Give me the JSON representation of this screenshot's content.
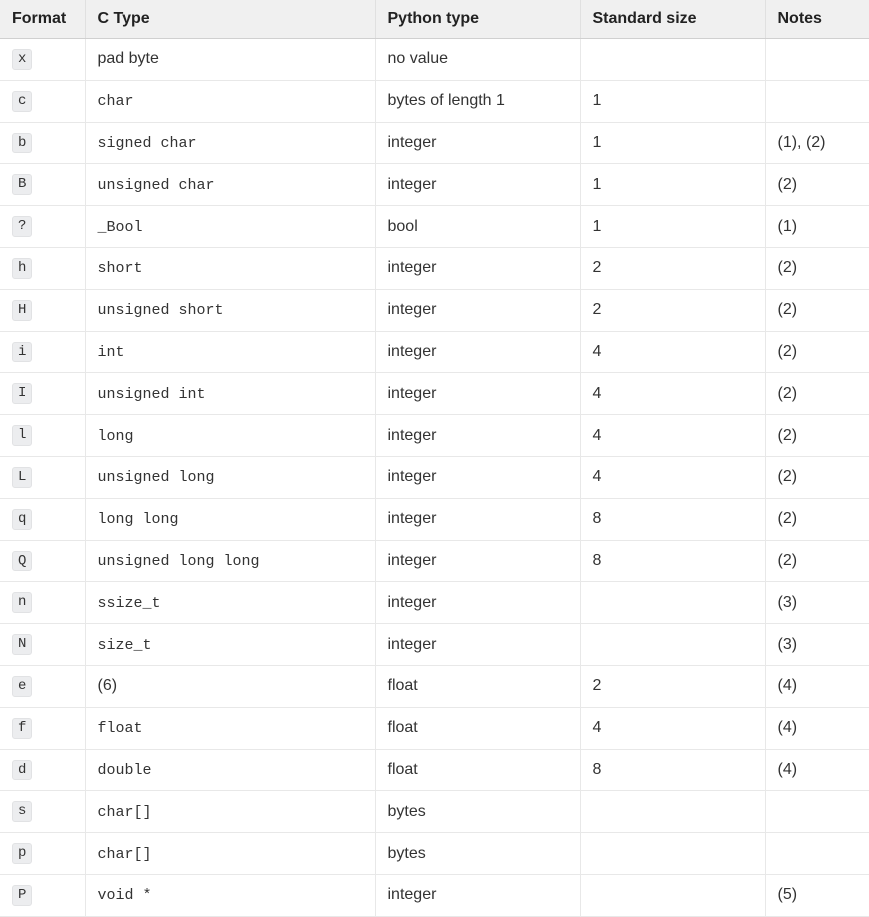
{
  "headers": {
    "format": "Format",
    "ctype": "C Type",
    "python": "Python type",
    "size": "Standard size",
    "notes": "Notes"
  },
  "rows": [
    {
      "format": "x",
      "ctype": "pad byte",
      "ctype_mono": false,
      "python": "no value",
      "size": "",
      "notes": ""
    },
    {
      "format": "c",
      "ctype": "char",
      "ctype_mono": true,
      "python": "bytes of length 1",
      "size": "1",
      "notes": ""
    },
    {
      "format": "b",
      "ctype": "signed char",
      "ctype_mono": true,
      "python": "integer",
      "size": "1",
      "notes": "(1), (2)"
    },
    {
      "format": "B",
      "ctype": "unsigned char",
      "ctype_mono": true,
      "python": "integer",
      "size": "1",
      "notes": "(2)"
    },
    {
      "format": "?",
      "ctype": "_Bool",
      "ctype_mono": true,
      "python": "bool",
      "size": "1",
      "notes": "(1)"
    },
    {
      "format": "h",
      "ctype": "short",
      "ctype_mono": true,
      "python": "integer",
      "size": "2",
      "notes": "(2)"
    },
    {
      "format": "H",
      "ctype": "unsigned short",
      "ctype_mono": true,
      "python": "integer",
      "size": "2",
      "notes": "(2)"
    },
    {
      "format": "i",
      "ctype": "int",
      "ctype_mono": true,
      "python": "integer",
      "size": "4",
      "notes": "(2)"
    },
    {
      "format": "I",
      "ctype": "unsigned int",
      "ctype_mono": true,
      "python": "integer",
      "size": "4",
      "notes": "(2)"
    },
    {
      "format": "l",
      "ctype": "long",
      "ctype_mono": true,
      "python": "integer",
      "size": "4",
      "notes": "(2)"
    },
    {
      "format": "L",
      "ctype": "unsigned long",
      "ctype_mono": true,
      "python": "integer",
      "size": "4",
      "notes": "(2)"
    },
    {
      "format": "q",
      "ctype": "long long",
      "ctype_mono": true,
      "python": "integer",
      "size": "8",
      "notes": "(2)"
    },
    {
      "format": "Q",
      "ctype": "unsigned long long",
      "ctype_mono": true,
      "python": "integer",
      "size": "8",
      "notes": "(2)"
    },
    {
      "format": "n",
      "ctype": "ssize_t",
      "ctype_mono": true,
      "python": "integer",
      "size": "",
      "notes": "(3)"
    },
    {
      "format": "N",
      "ctype": "size_t",
      "ctype_mono": true,
      "python": "integer",
      "size": "",
      "notes": "(3)"
    },
    {
      "format": "e",
      "ctype": "(6)",
      "ctype_mono": false,
      "python": "float",
      "size": "2",
      "notes": "(4)"
    },
    {
      "format": "f",
      "ctype": "float",
      "ctype_mono": true,
      "python": "float",
      "size": "4",
      "notes": "(4)"
    },
    {
      "format": "d",
      "ctype": "double",
      "ctype_mono": true,
      "python": "float",
      "size": "8",
      "notes": "(4)"
    },
    {
      "format": "s",
      "ctype": "char[]",
      "ctype_mono": true,
      "python": "bytes",
      "size": "",
      "notes": ""
    },
    {
      "format": "p",
      "ctype": "char[]",
      "ctype_mono": true,
      "python": "bytes",
      "size": "",
      "notes": ""
    },
    {
      "format": "P",
      "ctype": "void *",
      "ctype_mono": true,
      "python": "integer",
      "size": "",
      "notes": "(5)"
    }
  ]
}
